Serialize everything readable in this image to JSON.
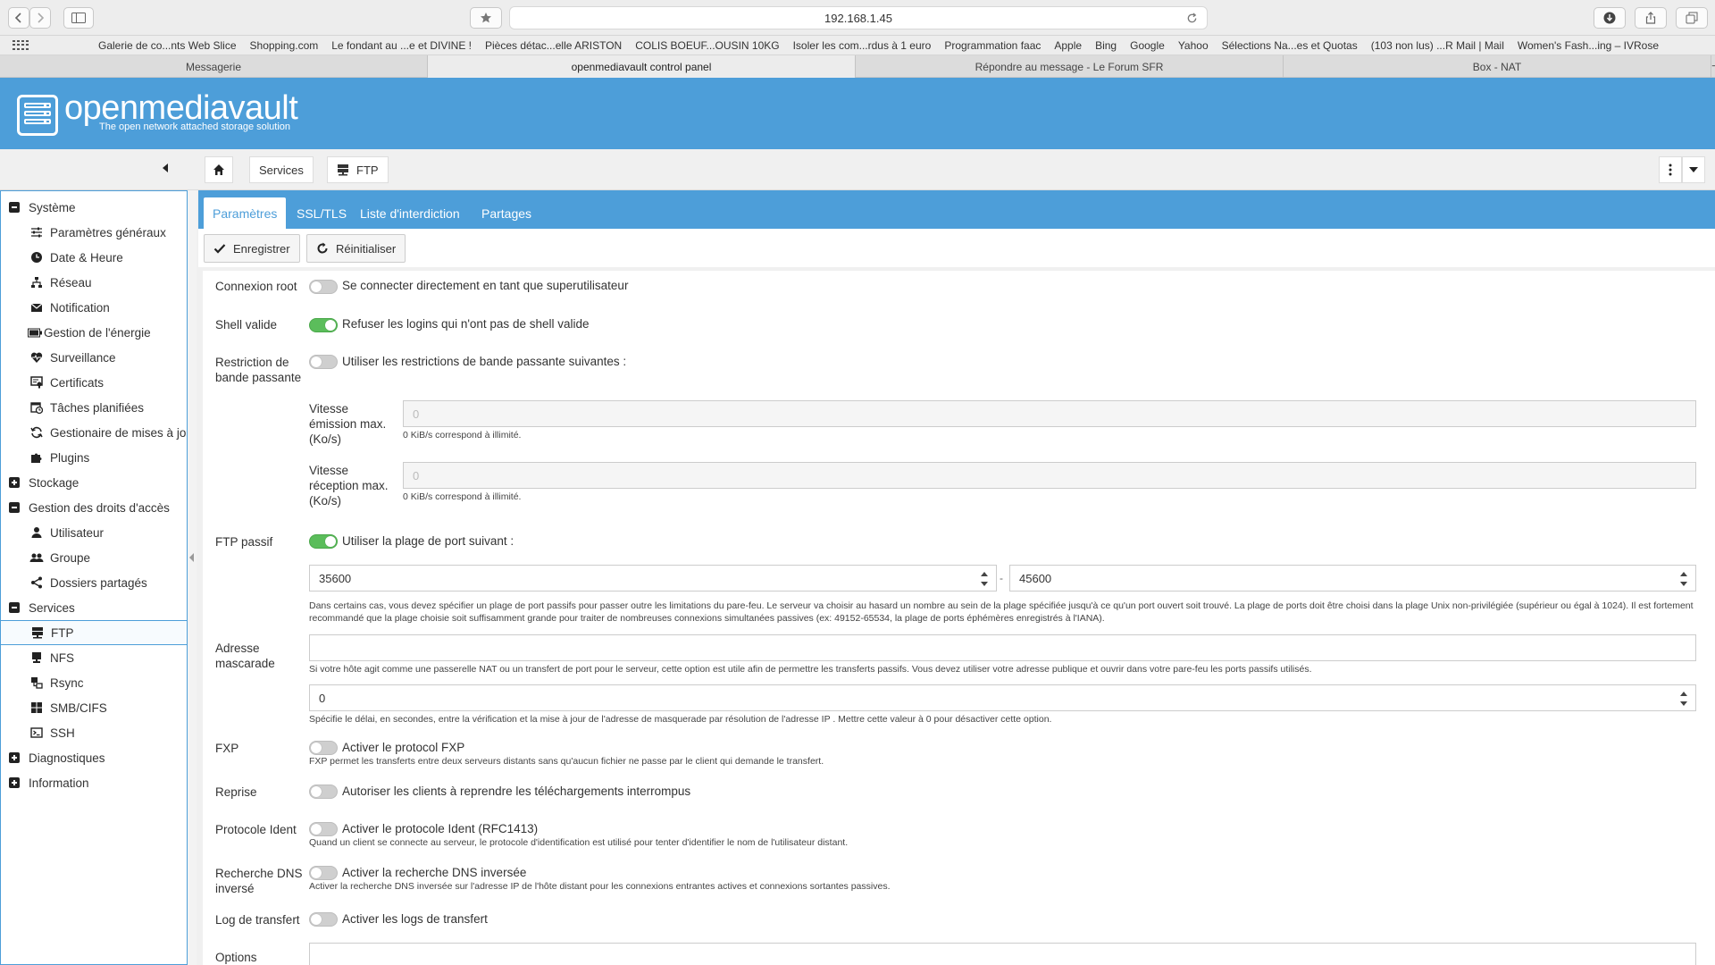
{
  "browser": {
    "address": "192.168.1.45",
    "bookmarks": [
      "Galerie de co...nts Web Slice",
      "Shopping.com",
      "Le fondant au ...e et DIVINE !",
      "Pièces détac...elle ARISTON",
      "COLIS BOEUF...OUSIN 10KG",
      "Isoler les com...rdus à 1 euro",
      "Programmation faac",
      "Apple",
      "Bing",
      "Google",
      "Yahoo",
      "Sélections Na...es et Quotas",
      "(103 non lus) ...R Mail | Mail",
      "Women's Fash...ing – IVRose"
    ],
    "tabs": [
      "Messagerie",
      "openmediavault control panel",
      "Répondre au message - Le Forum SFR",
      "Box - NAT"
    ],
    "active_tab": 1,
    "new_tab_label": "+"
  },
  "header": {
    "brand": "openmediavault",
    "tagline": "The open network attached storage solution"
  },
  "breadcrumb": {
    "services": "Services",
    "ftp": "FTP"
  },
  "sidebar": {
    "items": [
      {
        "label": "Système",
        "type": "cat",
        "state": "minus"
      },
      {
        "label": "Paramètres généraux",
        "type": "sub",
        "icon": "sliders-icon"
      },
      {
        "label": "Date & Heure",
        "type": "sub",
        "icon": "clock-icon"
      },
      {
        "label": "Réseau",
        "type": "sub",
        "icon": "network-icon"
      },
      {
        "label": "Notification",
        "type": "sub",
        "icon": "envelope-icon"
      },
      {
        "label": "Gestion de l'énergie",
        "type": "sub",
        "icon": "battery-icon"
      },
      {
        "label": "Surveillance",
        "type": "sub",
        "icon": "heartbeat-icon"
      },
      {
        "label": "Certificats",
        "type": "sub",
        "icon": "certificate-icon"
      },
      {
        "label": "Tâches planifiées",
        "type": "sub",
        "icon": "calendar-clock-icon"
      },
      {
        "label": "Gestionaire de mises à jour",
        "type": "sub",
        "icon": "refresh-icon"
      },
      {
        "label": "Plugins",
        "type": "sub",
        "icon": "puzzle-icon"
      },
      {
        "label": "Stockage",
        "type": "cat",
        "state": "plus"
      },
      {
        "label": "Gestion des droits d'accès",
        "type": "cat",
        "state": "minus"
      },
      {
        "label": "Utilisateur",
        "type": "sub",
        "icon": "user-icon"
      },
      {
        "label": "Groupe",
        "type": "sub",
        "icon": "users-icon"
      },
      {
        "label": "Dossiers partagés",
        "type": "sub",
        "icon": "share-icon"
      },
      {
        "label": "Services",
        "type": "cat",
        "state": "minus"
      },
      {
        "label": "FTP",
        "type": "sub",
        "icon": "server-icon",
        "selected": true
      },
      {
        "label": "NFS",
        "type": "sub",
        "icon": "desktop-icon"
      },
      {
        "label": "Rsync",
        "type": "sub",
        "icon": "rsync-icon"
      },
      {
        "label": "SMB/CIFS",
        "type": "sub",
        "icon": "windows-icon"
      },
      {
        "label": "SSH",
        "type": "sub",
        "icon": "terminal-icon"
      },
      {
        "label": "Diagnostiques",
        "type": "cat",
        "state": "plus"
      },
      {
        "label": "Information",
        "type": "cat",
        "state": "plus"
      }
    ]
  },
  "tabs": [
    "Paramètres",
    "SSL/TLS",
    "Liste d'interdiction",
    "Partages"
  ],
  "actions": {
    "save": "Enregistrer",
    "reset": "Réinitialiser"
  },
  "form": {
    "root_label": "Connexion root",
    "root_toggle": "Se connecter directement en tant que superutilisateur",
    "root_on": false,
    "shell_label": "Shell valide",
    "shell_toggle": "Refuser les logins qui n'ont pas de shell valide",
    "shell_on": true,
    "bw_label": "Restriction de bande passante",
    "bw_toggle": "Utiliser les restrictions de bande passante suivantes :",
    "bw_on": false,
    "up_label": "Vitesse émission max. (Ko/s)",
    "up_value": "0",
    "up_help": "0 KiB/s correspond à illimité.",
    "down_label": "Vitesse réception max. (Ko/s)",
    "down_value": "0",
    "down_help": "0 KiB/s correspond à illimité.",
    "passive_label": "FTP passif",
    "passive_toggle": "Utiliser la plage de port suivant :",
    "passive_on": true,
    "port_min": "35600",
    "port_sep": "-",
    "port_max": "45600",
    "passive_help": "Dans certains cas, vous devez spécifier un plage de port passifs pour passer outre les limitations du pare-feu. Le serveur va choisir au hasard un nombre au sein de la plage spécifiée jusqu'à ce qu'un port ouvert soit trouvé. La plage de ports doit être choisi dans la plage Unix non-privilégiée (supérieur ou égal à 1024). Il est fortement recommandé que la plage choisie soit suffisamment grande pour traiter de nombreuses connexions simultanées passives (ex: 49152-65534, la plage de ports éphémères enregistrés à l'IANA).",
    "masq_label": "Adresse mascarade",
    "masq_value": "",
    "masq_help": "Si votre hôte agit comme une passerelle NAT ou un transfert de port pour le serveur, cette option est utile afin de permettre les transferts passifs. Vous devez utiliser votre adresse publique et ouvrir dans votre pare-feu les ports passifs utilisés.",
    "delay_value": "0",
    "delay_help": "Spécifie le délai, en secondes, entre la vérification et la mise à jour de l'adresse de masquerade par résolution de l'adresse IP . Mettre cette valeur à 0 pour désactiver cette option.",
    "fxp_label": "FXP",
    "fxp_toggle": "Activer le protocol FXP",
    "fxp_on": false,
    "fxp_help": "FXP permet les transferts entre deux serveurs distants sans qu'aucun fichier ne passe par le client qui demande le transfert.",
    "resume_label": "Reprise",
    "resume_toggle": "Autoriser les clients à reprendre les téléchargements interrompus",
    "resume_on": false,
    "ident_label": "Protocole Ident",
    "ident_toggle": "Activer le protocole Ident (RFC1413)",
    "ident_on": false,
    "ident_help": "Quand un client se connecte au serveur, le protocole d'identification est utilisé pour tenter d'identifier le nom de l'utilisateur distant.",
    "dns_label": "Recherche DNS inversé",
    "dns_toggle": "Activer la recherche DNS inversée",
    "dns_on": false,
    "dns_help": "Activer la recherche DNS inversée sur l'adresse IP de l'hôte distant pour les connexions entrantes actives et connexions sortantes passives.",
    "log_label": "Log de transfert",
    "log_toggle": "Activer les logs de transfert",
    "log_on": false,
    "options_label": "Options"
  },
  "colors": {
    "accent": "#4d9ed9",
    "toggle_on": "#5bbd5b"
  }
}
